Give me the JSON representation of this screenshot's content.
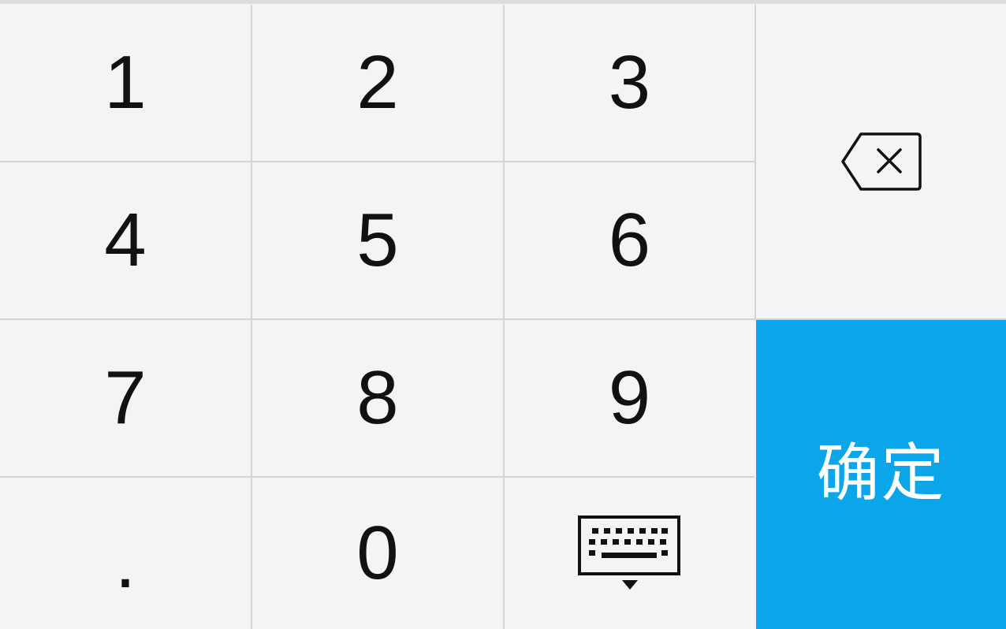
{
  "keypad": {
    "keys": {
      "k1": "1",
      "k2": "2",
      "k3": "3",
      "k4": "4",
      "k5": "5",
      "k6": "6",
      "k7": "7",
      "k8": "8",
      "k9": "9",
      "k0": "0",
      "dot": "."
    },
    "confirm_label": "确定",
    "backspace_icon": "backspace-icon",
    "keyboard_icon": "hide-keyboard-icon",
    "colors": {
      "background": "#f4f4f4",
      "divider": "#d4d4d4",
      "confirm": "#0aa6e9",
      "text": "#111111"
    }
  }
}
